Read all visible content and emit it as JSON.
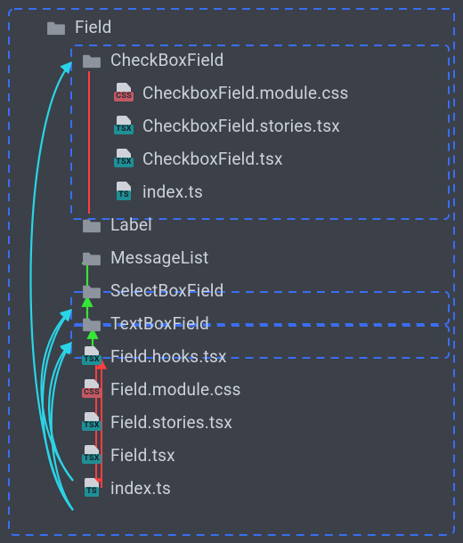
{
  "colors": {
    "background": "#3b4049",
    "text": "#cdd2da",
    "dash_border": "#3a6ef2",
    "arrow_cyan": "#2ad4e6",
    "arrow_green": "#36e636",
    "arrow_red": "#ff3e3e",
    "folder": "#8e949d",
    "badge_css": "#c35963",
    "badge_tsx": "#1f8f97",
    "badge_ts": "#1f8f97"
  },
  "tree": {
    "root": {
      "name": "Field",
      "type": "folder",
      "children": [
        {
          "name": "CheckBoxField",
          "type": "folder",
          "highlighted": true,
          "children": [
            {
              "name": "CheckboxField.module.css",
              "type": "file",
              "badge": "CSS"
            },
            {
              "name": "CheckboxField.stories.tsx",
              "type": "file",
              "badge": "TSX"
            },
            {
              "name": "CheckboxField.tsx",
              "type": "file",
              "badge": "TSX"
            },
            {
              "name": "index.ts",
              "type": "file",
              "badge": "TS"
            }
          ]
        },
        {
          "name": "Label",
          "type": "folder"
        },
        {
          "name": "MessageList",
          "type": "folder"
        },
        {
          "name": "SelectBoxField",
          "type": "folder",
          "highlighted": true
        },
        {
          "name": "TextBoxField",
          "type": "folder",
          "highlighted": true
        },
        {
          "name": "Field.hooks.tsx",
          "type": "file",
          "badge": "TSX"
        },
        {
          "name": "Field.module.css",
          "type": "file",
          "badge": "CSS"
        },
        {
          "name": "Field.stories.tsx",
          "type": "file",
          "badge": "TSX"
        },
        {
          "name": "Field.tsx",
          "type": "file",
          "badge": "TSX"
        },
        {
          "name": "index.ts",
          "type": "file",
          "badge": "TS"
        }
      ]
    }
  },
  "relations": {
    "cyan_arrows_desc": "index.ts and Field.tsx point to CheckBoxField, SelectBoxField, TextBoxField folders",
    "green_arrows_desc": "folders point up to parent Field composition",
    "red_arrows_desc": "Field files reference sibling Field files"
  }
}
